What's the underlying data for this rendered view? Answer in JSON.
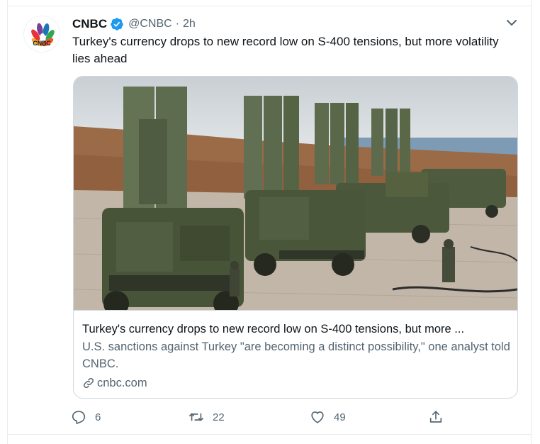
{
  "tweet": {
    "author_name": "CNBC",
    "author_handle": "@CNBC",
    "separator": "·",
    "timestamp": "2h",
    "avatar_logo_text": "CNBC",
    "verified": true,
    "text": "Turkey's currency drops to new record low on S-400 tensions, but more volatility lies ahead"
  },
  "card": {
    "title": "Turkey's currency drops to new record low on S-400 tensions, but more ...",
    "description": "U.S. sanctions against Turkey \"are becoming a distinct possibility,\" one analyst told CNBC.",
    "domain": "cnbc.com"
  },
  "actions": {
    "reply_count": "6",
    "retweet_count": "22",
    "like_count": "49"
  },
  "colors": {
    "text_primary": "#0f1419",
    "text_secondary": "#536471",
    "verified_blue": "#1d9bf0",
    "border": "#cfd9de"
  },
  "icons": [
    "verified-badge-icon",
    "chevron-down-icon",
    "link-icon",
    "reply-icon",
    "retweet-icon",
    "like-icon",
    "share-icon"
  ]
}
